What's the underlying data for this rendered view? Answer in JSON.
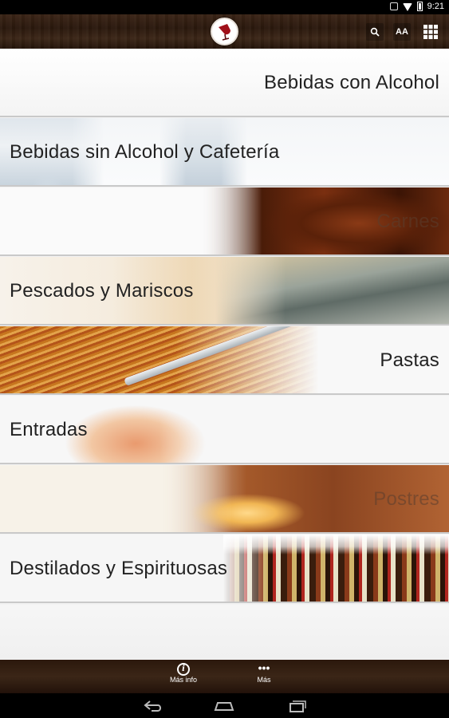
{
  "status_bar": {
    "time": "9:21"
  },
  "toolbar": {
    "logo_icon": "wine-glass-icon",
    "search_icon": "search-icon",
    "font_size_label": "AA",
    "grid_icon": "grid-icon"
  },
  "menu": {
    "items": [
      {
        "label": "Bebidas con Alcohol"
      },
      {
        "label": "Bebidas sin Alcohol y Cafetería"
      },
      {
        "label": "Carnes"
      },
      {
        "label": "Pescados y Mariscos"
      },
      {
        "label": "Pastas"
      },
      {
        "label": "Entradas"
      },
      {
        "label": "Postres"
      },
      {
        "label": "Destilados y Espirituosas"
      }
    ]
  },
  "bottom_bar": {
    "info_label": "Más info",
    "more_label": "Más"
  },
  "colors": {
    "wood": "#3a2416",
    "text": "#222222",
    "background": "#f2f2f2"
  }
}
